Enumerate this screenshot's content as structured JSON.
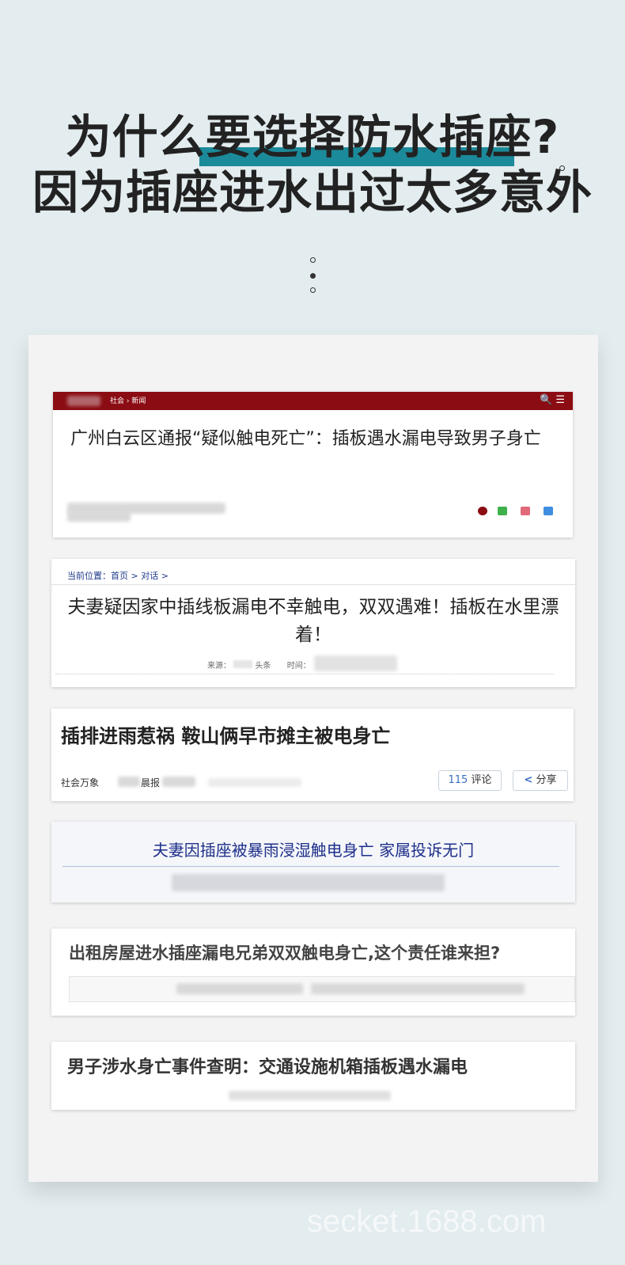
{
  "headline": {
    "line1": "为什么要选择防水插座?",
    "line2": "因为插座进水出过太多意外"
  },
  "card1": {
    "breadcrumb": "社会 › 新闻",
    "title": "广州白云区通报“疑似触电死亡”：插板遇水漏电导致男子身亡",
    "search_icon": "🔍",
    "menu_icon": "☰",
    "share_colors": [
      "#8b0c13",
      "#3fb14a",
      "#e06a7a",
      "#3f8ee0"
    ]
  },
  "card2": {
    "breadcrumb": "当前位置：首页 > 对话 >",
    "title": "夫妻疑因家中插线板漏电不幸触电，双双遇难！插板在水里漂着！",
    "source_label": "来源：",
    "source_value": "头条",
    "time_label": "时间："
  },
  "card3": {
    "title": "插排进雨惹祸 鞍山俩早市摊主被电身亡",
    "category": "社会万象",
    "source": "晨报",
    "comment_count": "115",
    "comment_label": "评论",
    "share_label": "分享",
    "share_icon": "<"
  },
  "card4": {
    "title": "夫妻因插座被暴雨浸湿触电身亡 家属投诉无门"
  },
  "card5": {
    "title": "出租房屋进水插座漏电兄弟双双触电身亡,这个责任谁来担?"
  },
  "card6": {
    "title": "男子涉水身亡事件查明：交通设施机箱插板遇水漏电"
  },
  "watermark": "secket.1688.com"
}
